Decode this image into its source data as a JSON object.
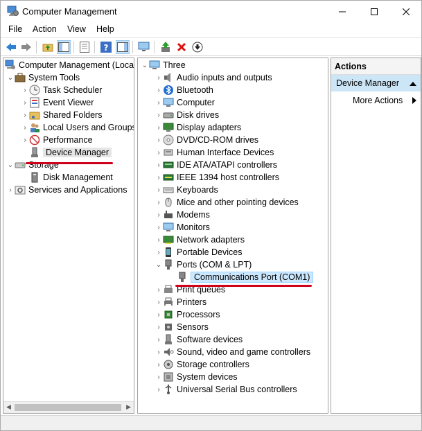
{
  "window": {
    "title": "Computer Management"
  },
  "menu": {
    "items": [
      "File",
      "Action",
      "View",
      "Help"
    ]
  },
  "left_tree": {
    "root": "Computer Management (Local",
    "system_tools": "System Tools",
    "task_scheduler": "Task Scheduler",
    "event_viewer": "Event Viewer",
    "shared_folders": "Shared Folders",
    "local_users": "Local Users and Groups",
    "performance": "Performance",
    "device_manager": "Device Manager",
    "storage": "Storage",
    "disk_management": "Disk Management",
    "services": "Services and Applications"
  },
  "device_tree": {
    "root": "Three",
    "categories": [
      "Audio inputs and outputs",
      "Bluetooth",
      "Computer",
      "Disk drives",
      "Display adapters",
      "DVD/CD-ROM drives",
      "Human Interface Devices",
      "IDE ATA/ATAPI controllers",
      "IEEE 1394 host controllers",
      "Keyboards",
      "Mice and other pointing devices",
      "Modems",
      "Monitors",
      "Network adapters",
      "Portable Devices",
      "Ports (COM & LPT)",
      "Print queues",
      "Printers",
      "Processors",
      "Sensors",
      "Software devices",
      "Sound, video and game controllers",
      "Storage controllers",
      "System devices",
      "Universal Serial Bus controllers"
    ],
    "port_child": "Communications Port (COM1)"
  },
  "actions": {
    "header": "Actions",
    "section": "Device Manager",
    "more": "More Actions"
  },
  "colors": {
    "selection": "#cce8ff",
    "annotation": "#d0021b",
    "accent": "#1e73c8"
  }
}
